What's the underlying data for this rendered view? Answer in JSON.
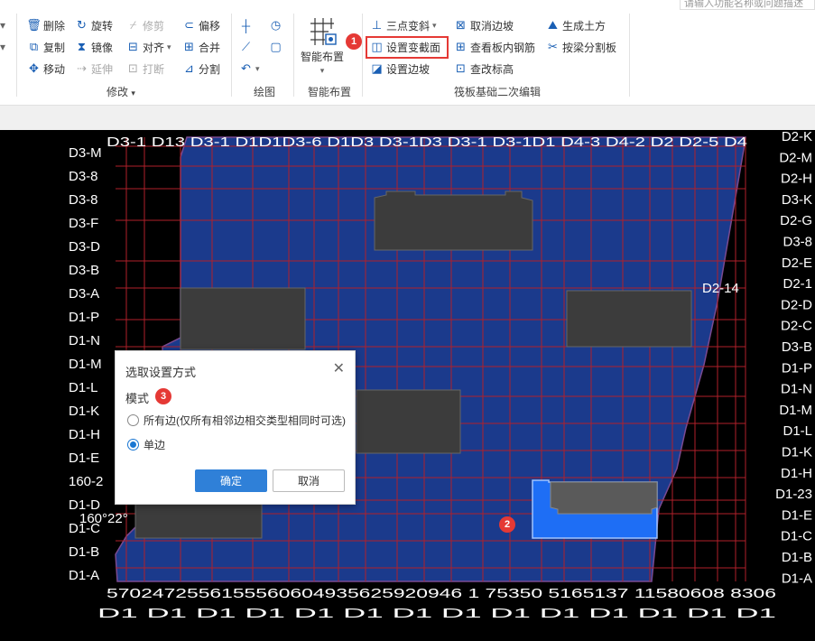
{
  "search": {
    "placeholder": "请输入功能名称或问题描述"
  },
  "ribbon": {
    "modify": {
      "label": "修改",
      "buttons": [
        {
          "label": "删除",
          "icon": "delete-icon"
        },
        {
          "label": "旋转",
          "icon": "rotate-icon"
        },
        {
          "label": "修剪",
          "icon": "trim-icon",
          "disabled": true
        },
        {
          "label": "偏移",
          "icon": "offset-icon"
        },
        {
          "label": "复制",
          "icon": "copy-icon"
        },
        {
          "label": "镜像",
          "icon": "mirror-icon"
        },
        {
          "label": "对齐",
          "icon": "align-icon"
        },
        {
          "label": "合并",
          "icon": "merge-icon"
        },
        {
          "label": "移动",
          "icon": "move-icon"
        },
        {
          "label": "延伸",
          "icon": "extend-icon",
          "disabled": true
        },
        {
          "label": "打断",
          "icon": "break-icon",
          "disabled": true
        },
        {
          "label": "分割",
          "icon": "split-icon"
        }
      ]
    },
    "draw": {
      "label": "绘图"
    },
    "smart": {
      "label": "智能布置",
      "button": "智能布置"
    },
    "raft": {
      "label": "筏板基础二次编辑",
      "buttons": [
        {
          "label": "三点变斜",
          "icon": "three-point-slope-icon"
        },
        {
          "label": "取消边坡",
          "icon": "cancel-slope-icon"
        },
        {
          "label": "生成土方",
          "icon": "generate-earthwork-icon"
        },
        {
          "label": "设置变截面",
          "icon": "set-variable-section-icon"
        },
        {
          "label": "查看板内钢筋",
          "icon": "view-rebar-icon"
        },
        {
          "label": "按梁分割板",
          "icon": "split-by-beam-icon"
        },
        {
          "label": "设置边坡",
          "icon": "set-slope-icon"
        },
        {
          "label": "查改标高",
          "icon": "edit-elevation-icon"
        }
      ]
    }
  },
  "badges": [
    "1",
    "2",
    "3"
  ],
  "canvas": {
    "labels": {
      "left": [
        "D3-M",
        "D3-8",
        "D3-8",
        "D3-F",
        "D3-D",
        "D3-B",
        "D3-A",
        "D1-P",
        "D1-N",
        "D1-M",
        "D1-L",
        "D1-K",
        "D1-H",
        "D1-E",
        "160-2",
        "D1-D",
        "D1-C",
        "D1-B",
        "D1-A"
      ],
      "right": [
        "D2-K",
        "D2-M",
        "D2-H",
        "D3-K",
        "D2-G",
        "D3-8",
        "D2-E",
        "D2-1",
        "D2-D",
        "D2-C",
        "D3-B",
        "D1-P",
        "D1-N",
        "D1-M",
        "D1-L",
        "D1-K",
        "D1-H",
        "D1-23",
        "D1-E",
        "D1-C",
        "D1-B",
        "D1-A"
      ],
      "top": "D3-1 D13 D3-1 D1D1D3-6 D1D3 D3-1D3 D3-1 D3-1D1 D4-3 D4-2 D2 D2-5 D4",
      "bottom_numbers": "5702472556155560604935625920946 1 75350 5165137 11580608 8306",
      "bottom_codes": "D1 D1 D1 D1 D1 D1 D1 D1 D1 D1 D1 D1 D1 D1",
      "d2_14": "D2-14",
      "angle": "160°22°"
    }
  },
  "dialog": {
    "title": "选取设置方式",
    "mode_label": "模式",
    "option_all": "所有边(仅所有相邻边相交类型相同时可选)",
    "option_single": "单边",
    "selected": "单边",
    "ok": "确定",
    "cancel": "取消"
  },
  "colors": {
    "slab": "#1b3a8c",
    "grid": "#b0202a",
    "selected": "#1e6ef5",
    "pit": "#3c3c3c",
    "accent": "#e53935"
  }
}
